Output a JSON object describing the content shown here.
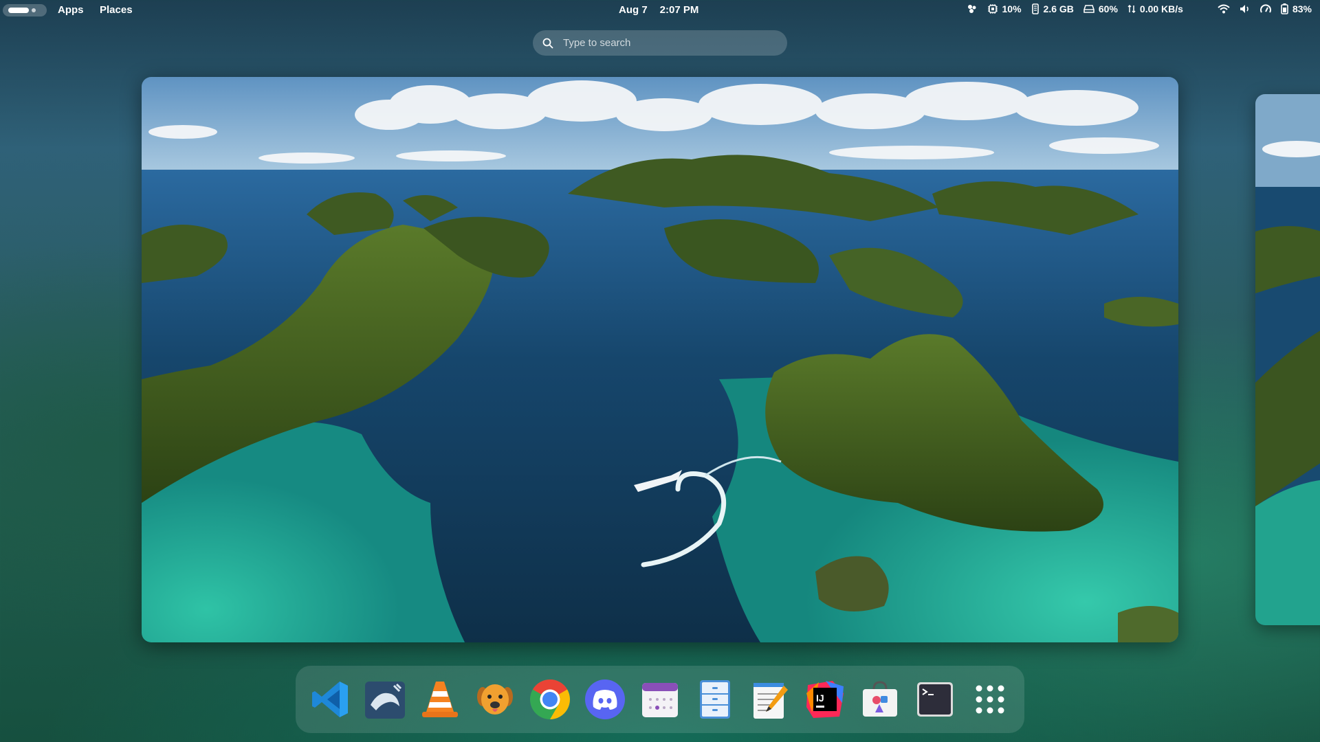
{
  "topbar": {
    "menu_apps": "Apps",
    "menu_places": "Places",
    "date": "Aug 7",
    "time": "2:07 PM",
    "tray": {
      "cpu": "10%",
      "memory": "2.6 GB",
      "disk": "60%",
      "network": "0.00 KB/s",
      "battery": "83%"
    }
  },
  "search": {
    "placeholder": "Type to search"
  },
  "dock": {
    "apps": [
      {
        "icon": "vscode-icon"
      },
      {
        "icon": "mysql-workbench-icon"
      },
      {
        "icon": "vlc-icon"
      },
      {
        "icon": "dog-app-icon"
      },
      {
        "icon": "chrome-icon"
      },
      {
        "icon": "discord-icon"
      },
      {
        "icon": "calendar-icon"
      },
      {
        "icon": "file-cabinet-icon"
      },
      {
        "icon": "text-editor-icon"
      },
      {
        "icon": "intellij-idea-icon"
      },
      {
        "icon": "software-store-icon"
      },
      {
        "icon": "terminal-icon"
      },
      {
        "icon": "app-grid-icon"
      }
    ]
  },
  "colors": {
    "sea_deep": "#123a55",
    "lagoon": "#1fb39a",
    "island": "#3d5a1e",
    "sky": "#7fa9c9"
  }
}
